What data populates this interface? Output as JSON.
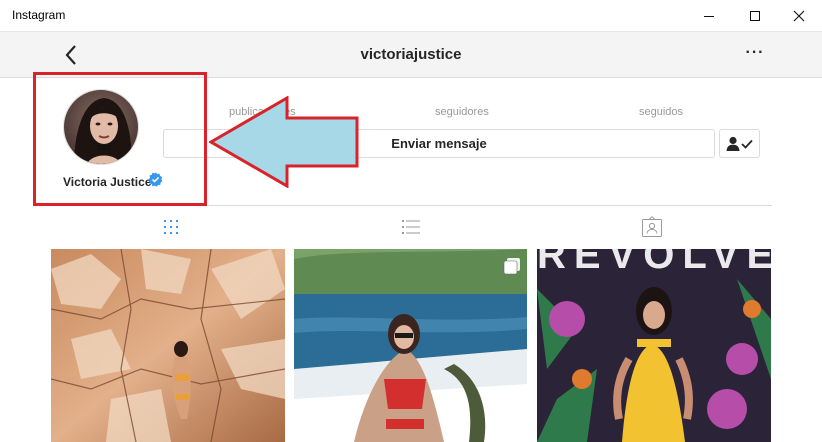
{
  "window": {
    "title": "Instagram"
  },
  "header": {
    "username": "victoriajustice",
    "more_label": "···"
  },
  "profile": {
    "display_name": "Victoria Justice",
    "stats": {
      "posts_label": "publicaciones",
      "followers_label": "seguidores",
      "following_label": "seguidos"
    },
    "message_button": "Enviar mensaje"
  },
  "photos": {
    "third_overlay_text": "REVOLVE"
  },
  "colors": {
    "annotation_red": "#d8232a",
    "arrow_fill": "#a6d8e8",
    "verified_blue": "#3897f0",
    "tab_active": "#3897f0"
  },
  "icons": [
    "back-icon",
    "more-icon",
    "verified-icon",
    "follow-check-icon",
    "grid-icon",
    "list-icon",
    "tagged-icon",
    "multi-photo-icon"
  ]
}
